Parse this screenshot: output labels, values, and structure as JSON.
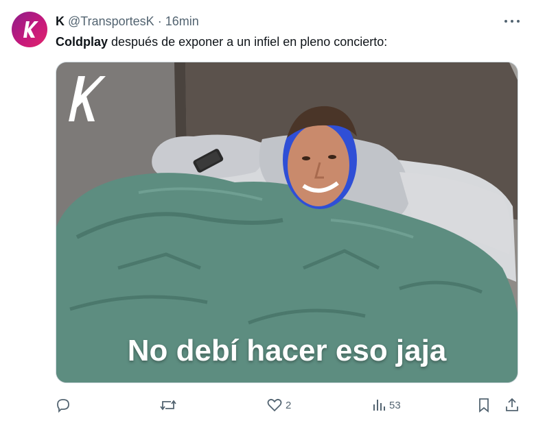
{
  "post": {
    "author_name": "K",
    "handle": "@TransportesK",
    "separator": "·",
    "time": "16min",
    "text_bold": "Coldplay",
    "text_rest": " después de exponer a un infiel en pleno concierto:",
    "avatar_letter": "K",
    "more_icon": "more-horizontal-icon"
  },
  "media": {
    "caption": "No debí hacer eso jaja",
    "watermark_letter": "K"
  },
  "actions": {
    "reply_icon": "reply-icon",
    "repost_icon": "repost-icon",
    "like_icon": "heart-icon",
    "like_count": "2",
    "views_icon": "views-icon",
    "views_count": "53",
    "bookmark_icon": "bookmark-icon",
    "share_icon": "share-icon"
  },
  "colors": {
    "avatar_gradient": [
      "#8e1e8a",
      "#e2246a"
    ],
    "text_primary": "#0f1419",
    "text_secondary": "#536471",
    "blanket": "#5a8a7c"
  }
}
